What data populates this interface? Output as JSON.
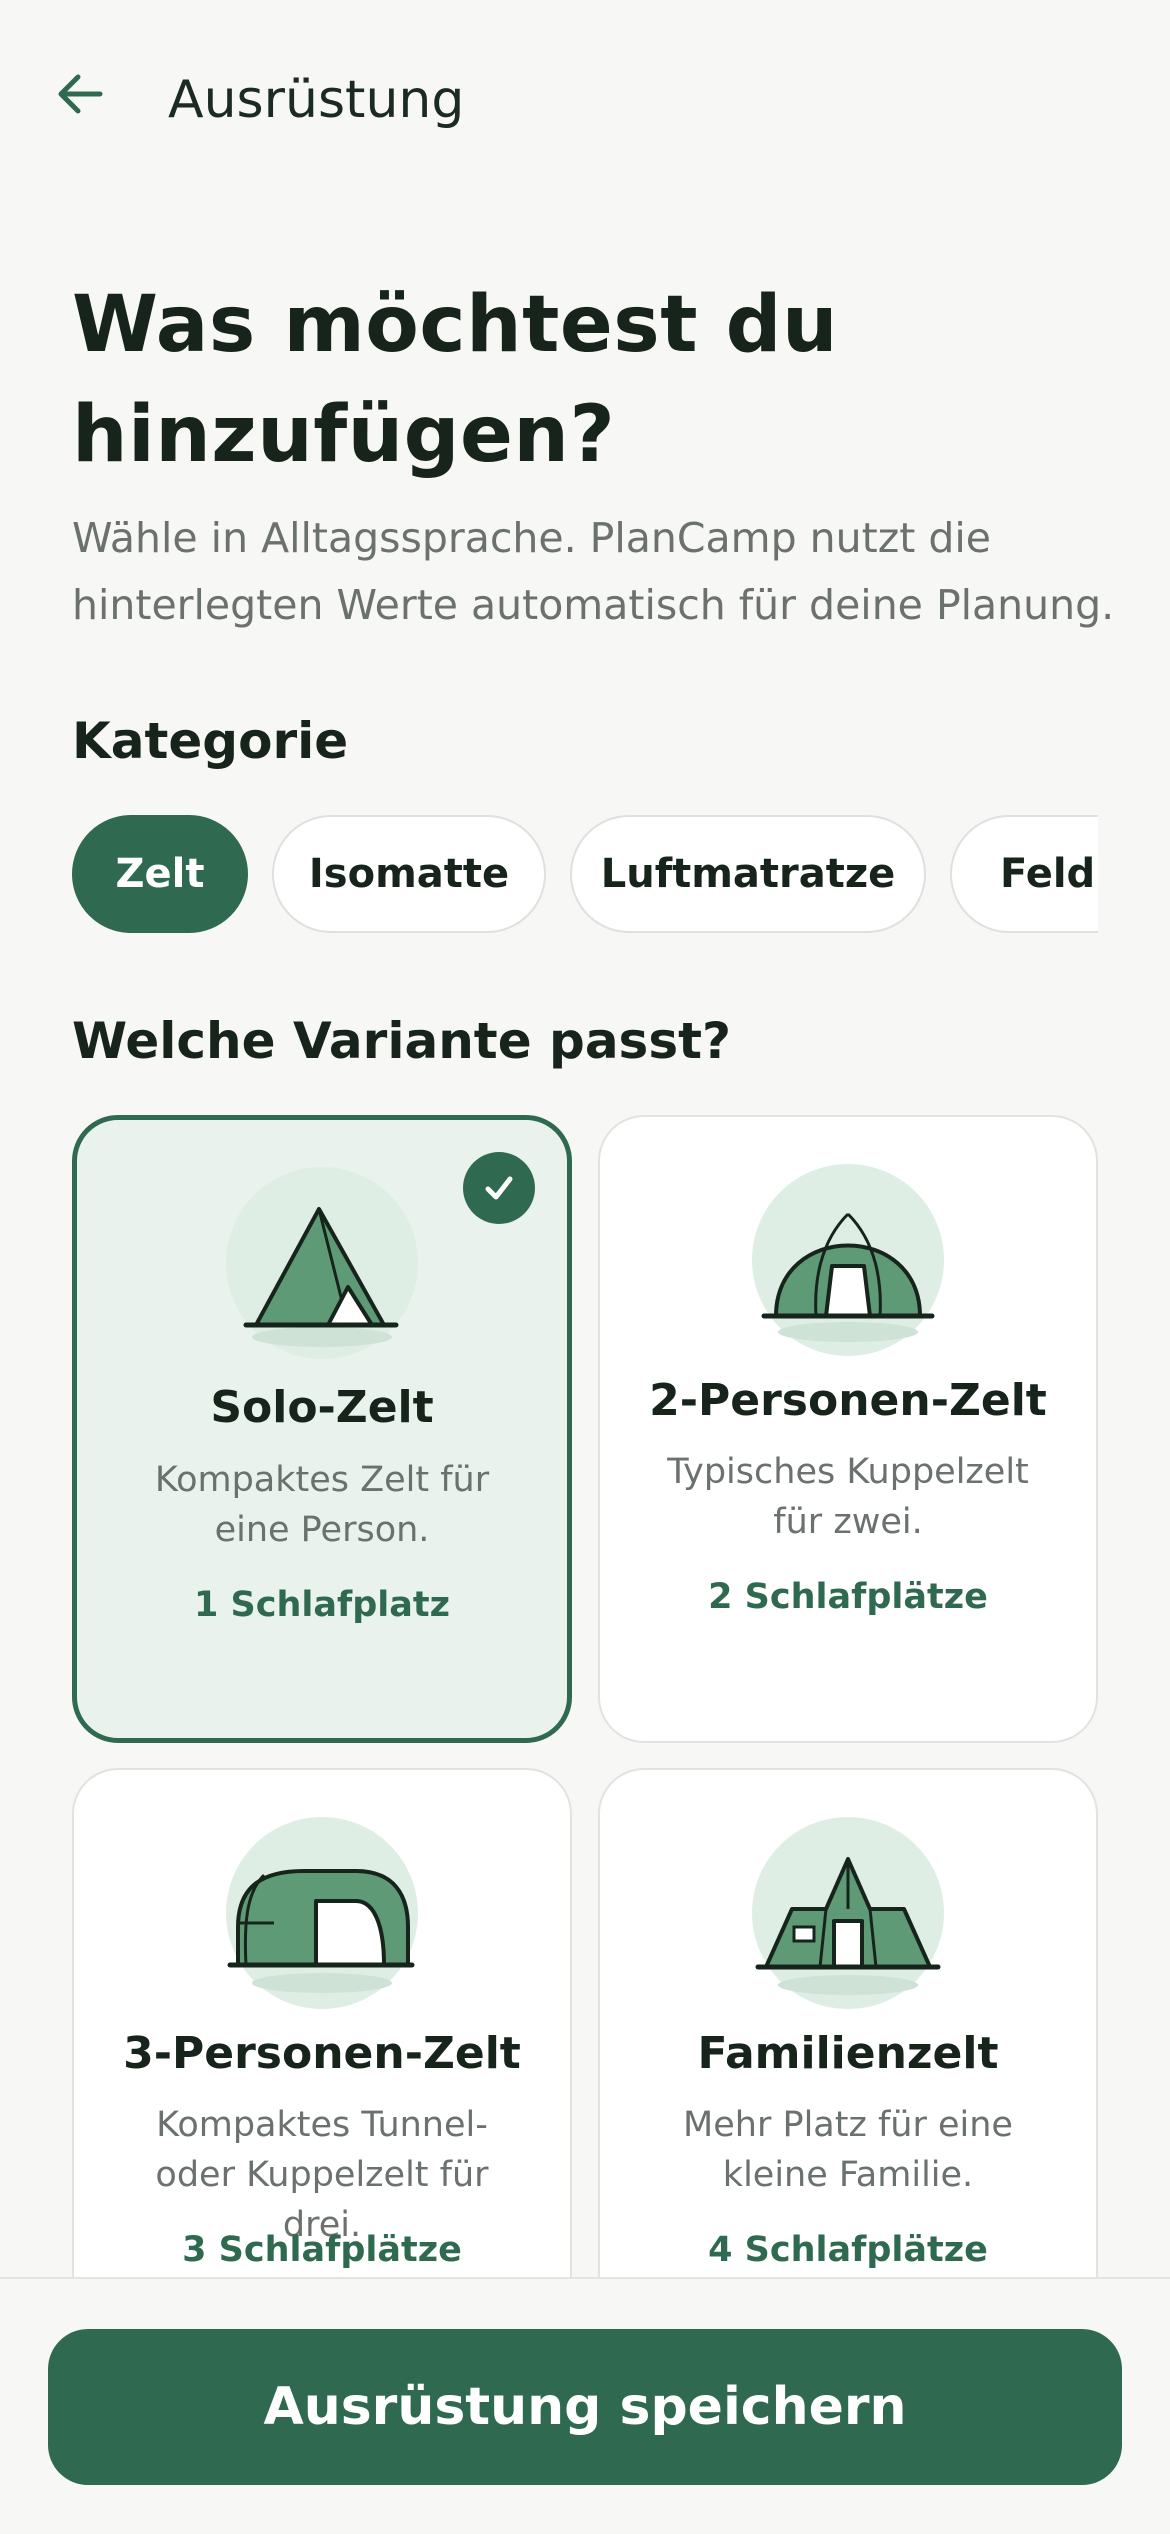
{
  "header": {
    "title": "Ausrüstung",
    "back_icon": "arrow-left-icon"
  },
  "intro": {
    "headline": "Was möchtest du hinzufügen?",
    "subtitle": "Wähle in Alltagssprache. PlanCamp nutzt die hinterlegten Werte automatisch für deine Planung."
  },
  "category": {
    "label": "Kategorie",
    "chips": [
      {
        "label": "Zelt",
        "selected": true
      },
      {
        "label": "Isomatte",
        "selected": false
      },
      {
        "label": "Luftmatratze",
        "selected": false
      },
      {
        "label": "Feldbett",
        "selected": false
      }
    ]
  },
  "variants": {
    "label": "Welche Variante passt?",
    "items": [
      {
        "title": "Solo-Zelt",
        "desc": "Kompaktes Zelt für eine Person.",
        "capacity": "1 Schlafplatz",
        "icon": "solo-tent-icon",
        "selected": true
      },
      {
        "title": "2-Personen-Zelt",
        "desc": "Typisches Kuppelzelt für zwei.",
        "capacity": "2 Schlafplätze",
        "icon": "dome-tent-icon",
        "selected": false
      },
      {
        "title": "3-Personen-Zelt",
        "desc": "Kompaktes Tunnel- oder Kuppelzelt für drei.",
        "capacity": "3 Schlafplätze",
        "icon": "tunnel-tent-icon",
        "selected": false
      },
      {
        "title": "Familienzelt",
        "desc": "Mehr Platz für eine kleine Familie.",
        "capacity": "4 Schlafplätze",
        "icon": "family-tent-icon",
        "selected": false
      }
    ]
  },
  "footer": {
    "save_label": "Ausrüstung speichern"
  },
  "colors": {
    "accent": "#2f6a50",
    "selected_bg": "#e9f2ed",
    "background": "#f7f7f5"
  }
}
